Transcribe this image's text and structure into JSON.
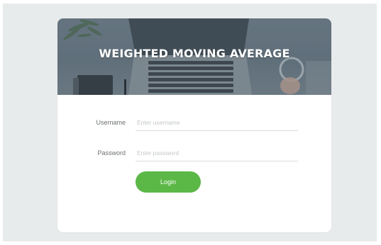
{
  "header": {
    "title": "WEIGHTED MOVING AVERAGE"
  },
  "form": {
    "username": {
      "label": "Username",
      "placeholder": "Enter username",
      "value": ""
    },
    "password": {
      "label": "Password",
      "placeholder": "Enter password",
      "value": ""
    },
    "login_label": "Login"
  },
  "colors": {
    "background": "#e8ebec",
    "card": "#ffffff",
    "banner": "#6f7e89",
    "accent": "#5bb847",
    "label": "#6b6f72",
    "placeholder": "#c3c7ca"
  },
  "icons": [
    "desk-photo-banner"
  ]
}
